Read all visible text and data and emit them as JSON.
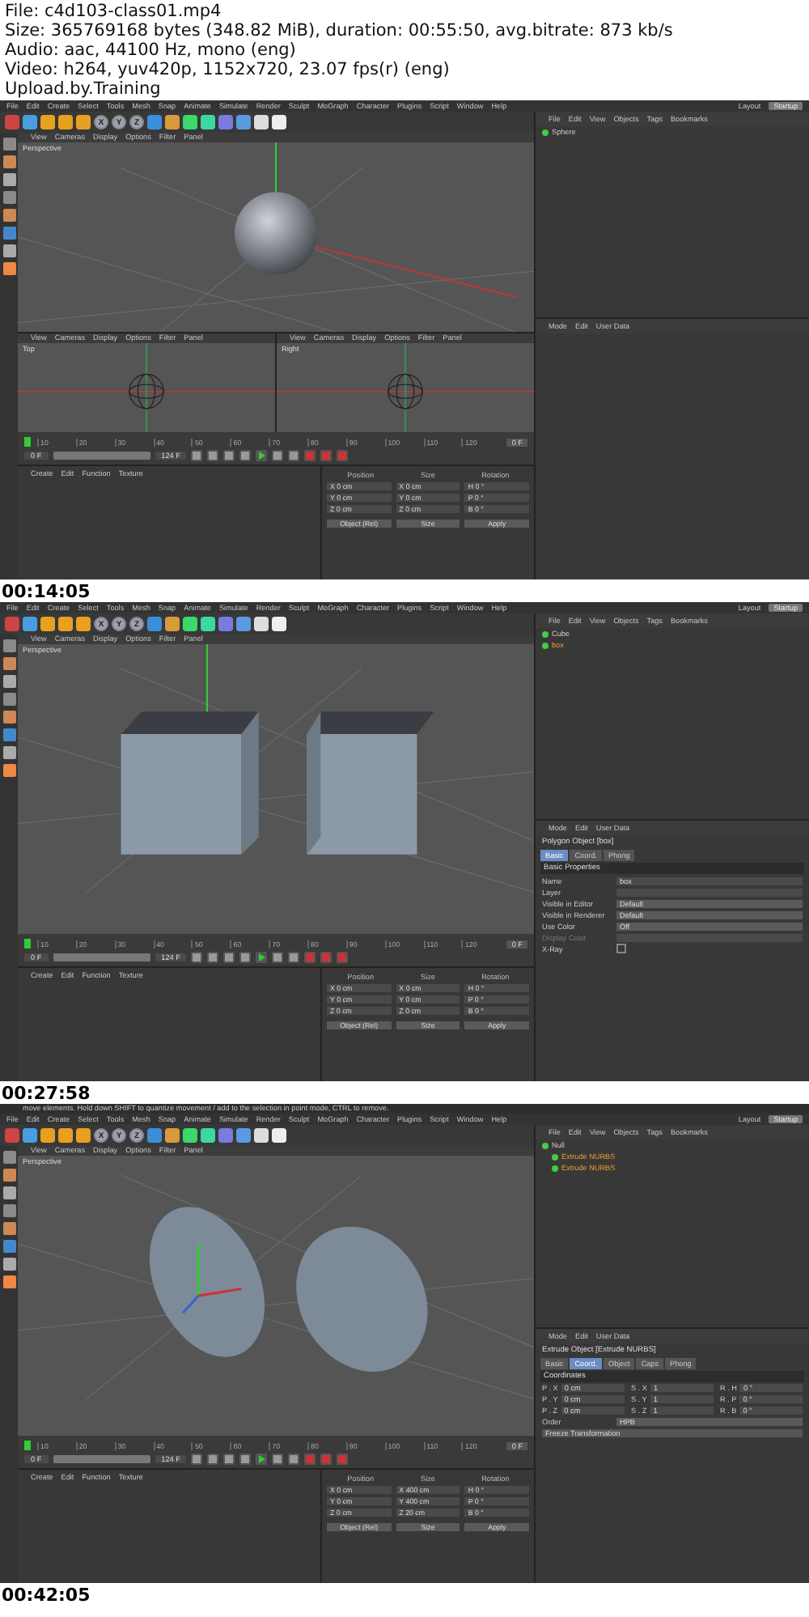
{
  "header": {
    "lines": [
      "File: c4d103-class01.mp4",
      "Size: 365769168 bytes (348.82 MiB), duration: 00:55:50, avg.bitrate: 873 kb/s",
      "Audio: aac, 44100 Hz, mono (eng)",
      "Video: h264, yuv420p, 1152x720, 23.07 fps(r) (eng)",
      "Upload.by.Training"
    ]
  },
  "frames": [
    {
      "timestamp": "00:14:05",
      "range": {
        "level": 1
      },
      "main_menu": [
        "File",
        "Edit",
        "Create",
        "Select",
        "Tools",
        "Mesh",
        "Snap",
        "Animate",
        "Simulate",
        "Render",
        "Sculpt",
        "MoGraph",
        "Character",
        "Plugins",
        "Script",
        "Window",
        "Help"
      ],
      "layout_label": "Layout",
      "layout_value": "Startup",
      "axis_buttons": [
        "X",
        "Y",
        "Z"
      ],
      "viewports": [
        {
          "label": "Perspective",
          "kind": "sphere",
          "menu": [
            "View",
            "Cameras",
            "Display",
            "Options",
            "Filter",
            "Panel"
          ]
        },
        {
          "label": "Top",
          "kind": "wire-sphere",
          "menu": [
            "View",
            "Cameras",
            "Display",
            "Options",
            "Filter",
            "Panel"
          ]
        },
        {
          "label": "Right",
          "kind": "wire-sphere",
          "menu": [
            "View",
            "Cameras",
            "Display",
            "Options",
            "Filter",
            "Panel"
          ]
        }
      ],
      "timeline_ticks": [
        "10",
        "20",
        "30",
        "40",
        "50",
        "60",
        "70",
        "80",
        "90",
        "100",
        "110",
        "120"
      ],
      "current_frame": "0 F",
      "start_frame": "0 F",
      "end_frame": "124 F",
      "material_menu": [
        "Create",
        "Edit",
        "Function",
        "Texture"
      ],
      "coords": {
        "headers": [
          "Position",
          "Size",
          "Rotation"
        ],
        "rows": [
          {
            "cells": [
              {
                "axis": "X",
                "value": "0 cm"
              },
              {
                "axis": "X",
                "value": "0 cm"
              },
              {
                "axis": "H",
                "value": "0 °"
              }
            ]
          },
          {
            "cells": [
              {
                "axis": "Y",
                "value": "0 cm"
              },
              {
                "axis": "Y",
                "value": "0 cm"
              },
              {
                "axis": "P",
                "value": "0 °"
              }
            ]
          },
          {
            "cells": [
              {
                "axis": "Z",
                "value": "0 cm"
              },
              {
                "axis": "Z",
                "value": "0 cm"
              },
              {
                "axis": "B",
                "value": "0 °"
              }
            ]
          }
        ],
        "mode": "Object (Rel)",
        "size_mode": "Size",
        "apply": "Apply"
      },
      "object_menu": [
        "File",
        "Edit",
        "View",
        "Objects",
        "Tags",
        "Bookmarks"
      ],
      "objects": [
        {
          "name": "Sphere",
          "selected": false
        }
      ],
      "attributes": {
        "menu": [
          "Mode",
          "Edit",
          "User Data"
        ]
      }
    },
    {
      "timestamp": "00:27:58",
      "range": {
        "level": 1
      },
      "main_menu": [
        "File",
        "Edit",
        "Create",
        "Select",
        "Tools",
        "Mesh",
        "Snap",
        "Animate",
        "Simulate",
        "Render",
        "Sculpt",
        "MoGraph",
        "Character",
        "Plugins",
        "Script",
        "Window",
        "Help"
      ],
      "layout_label": "Layout",
      "layout_value": "Startup",
      "axis_buttons": [
        "X",
        "Y",
        "Z"
      ],
      "viewports": [
        {
          "label": "Perspective",
          "kind": "cubes",
          "menu": [
            "View",
            "Cameras",
            "Display",
            "Options",
            "Filter",
            "Panel"
          ]
        }
      ],
      "timeline_ticks": [
        "10",
        "20",
        "30",
        "40",
        "50",
        "60",
        "70",
        "80",
        "90",
        "100",
        "110",
        "120"
      ],
      "current_frame": "0 F",
      "start_frame": "0 F",
      "end_frame": "124 F",
      "material_menu": [
        "Create",
        "Edit",
        "Function",
        "Texture"
      ],
      "coords": {
        "headers": [
          "Position",
          "Size",
          "Rotation"
        ],
        "rows": [
          {
            "cells": [
              {
                "axis": "X",
                "value": "0 cm"
              },
              {
                "axis": "X",
                "value": "0 cm"
              },
              {
                "axis": "H",
                "value": "0 °"
              }
            ]
          },
          {
            "cells": [
              {
                "axis": "Y",
                "value": "0 cm"
              },
              {
                "axis": "Y",
                "value": "0 cm"
              },
              {
                "axis": "P",
                "value": "0 °"
              }
            ]
          },
          {
            "cells": [
              {
                "axis": "Z",
                "value": "0 cm"
              },
              {
                "axis": "Z",
                "value": "0 cm"
              },
              {
                "axis": "B",
                "value": "0 °"
              }
            ]
          }
        ],
        "mode": "Object (Rel)",
        "size_mode": "Size",
        "apply": "Apply"
      },
      "object_menu": [
        "File",
        "Edit",
        "View",
        "Objects",
        "Tags",
        "Bookmarks"
      ],
      "objects": [
        {
          "name": "Cube",
          "selected": false
        },
        {
          "name": "box",
          "selected": true
        }
      ],
      "attributes": {
        "menu": [
          "Mode",
          "Edit",
          "User Data"
        ],
        "title": "Polygon Object [box]",
        "tabs": [
          {
            "label": "Basic",
            "selected": true
          },
          {
            "label": "Coord.",
            "selected": false
          },
          {
            "label": "Phong",
            "selected": false
          }
        ],
        "section": "Basic Properties",
        "rows": [
          {
            "kind": "field",
            "label": "Name",
            "value": "box"
          },
          {
            "kind": "field",
            "label": "Layer"
          },
          {
            "kind": "dropdown",
            "label": "Visible in Editor",
            "value": "Default"
          },
          {
            "kind": "dropdown",
            "label": "Visible in Renderer",
            "value": "Default"
          },
          {
            "kind": "dropdown",
            "label": "Use Color",
            "value": "Off"
          },
          {
            "kind": "field",
            "label": "Display Color",
            "disabled": true
          },
          {
            "kind": "checkbox",
            "label": "X-Ray",
            "checked": false
          }
        ]
      }
    },
    {
      "timestamp": "00:42:05",
      "range": {
        "level": 1
      },
      "status": "move elements. Hold down SHIFT to quantize movement / add to the selection in point mode, CTRL to remove.",
      "main_menu": [
        "File",
        "Edit",
        "Create",
        "Select",
        "Tools",
        "Mesh",
        "Snap",
        "Animate",
        "Simulate",
        "Render",
        "Sculpt",
        "MoGraph",
        "Character",
        "Plugins",
        "Script",
        "Window",
        "Help"
      ],
      "layout_label": "Layout",
      "layout_value": "Startup",
      "axis_buttons": [
        "X",
        "Y",
        "Z"
      ],
      "viewports": [
        {
          "label": "Perspective",
          "kind": "discs",
          "menu": [
            "View",
            "Cameras",
            "Display",
            "Options",
            "Filter",
            "Panel"
          ]
        }
      ],
      "timeline_ticks": [
        "10",
        "20",
        "30",
        "40",
        "50",
        "60",
        "70",
        "80",
        "90",
        "100",
        "110",
        "120"
      ],
      "current_frame": "0 F",
      "start_frame": "0 F",
      "end_frame": "124 F",
      "material_menu": [
        "Create",
        "Edit",
        "Function",
        "Texture"
      ],
      "coords": {
        "headers": [
          "Position",
          "Size",
          "Rotation"
        ],
        "rows": [
          {
            "cells": [
              {
                "axis": "X",
                "value": "0 cm"
              },
              {
                "axis": "X",
                "value": "400 cm"
              },
              {
                "axis": "H",
                "value": "0 °"
              }
            ]
          },
          {
            "cells": [
              {
                "axis": "Y",
                "value": "0 cm"
              },
              {
                "axis": "Y",
                "value": "400 cm"
              },
              {
                "axis": "P",
                "value": "0 °"
              }
            ]
          },
          {
            "cells": [
              {
                "axis": "Z",
                "value": "0 cm"
              },
              {
                "axis": "Z",
                "value": "20 cm"
              },
              {
                "axis": "B",
                "value": "0 °"
              }
            ]
          }
        ],
        "mode": "Object (Rel)",
        "size_mode": "Size",
        "apply": "Apply"
      },
      "object_menu": [
        "File",
        "Edit",
        "View",
        "Objects",
        "Tags",
        "Bookmarks"
      ],
      "objects": [
        {
          "name": "Null",
          "selected": false,
          "children": [
            {
              "name": "Extrude NURBS",
              "selected": true
            },
            {
              "name": "Extrude NURBS",
              "selected": true
            }
          ]
        }
      ],
      "attributes": {
        "menu": [
          "Mode",
          "Edit",
          "User Data"
        ],
        "title": "Extrude Object [Extrude NURBS]",
        "tabs": [
          {
            "label": "Basic",
            "selected": false
          },
          {
            "label": "Coord.",
            "selected": true
          },
          {
            "label": "Object",
            "selected": false
          },
          {
            "label": "Caps",
            "selected": false
          },
          {
            "label": "Phong",
            "selected": false
          }
        ],
        "section": "Coordinates",
        "rows": [
          {
            "kind": "coord",
            "fields": [
              {
                "label": "P . X",
                "value": "0 cm"
              },
              {
                "label": "S . X",
                "value": "1"
              },
              {
                "label": "R . H",
                "value": "0 °"
              }
            ]
          },
          {
            "kind": "coord",
            "fields": [
              {
                "label": "P . Y",
                "value": "0 cm"
              },
              {
                "label": "S . Y",
                "value": "1"
              },
              {
                "label": "R . P",
                "value": "0 °"
              }
            ]
          },
          {
            "kind": "coord",
            "fields": [
              {
                "label": "P . Z",
                "value": "0 cm"
              },
              {
                "label": "S . Z",
                "value": "1"
              },
              {
                "label": "R . B",
                "value": "0 °"
              }
            ]
          },
          {
            "kind": "dropdown",
            "label": "Order",
            "value": "HPB"
          },
          {
            "kind": "group",
            "label": "Freeze Transformation"
          }
        ]
      }
    }
  ]
}
